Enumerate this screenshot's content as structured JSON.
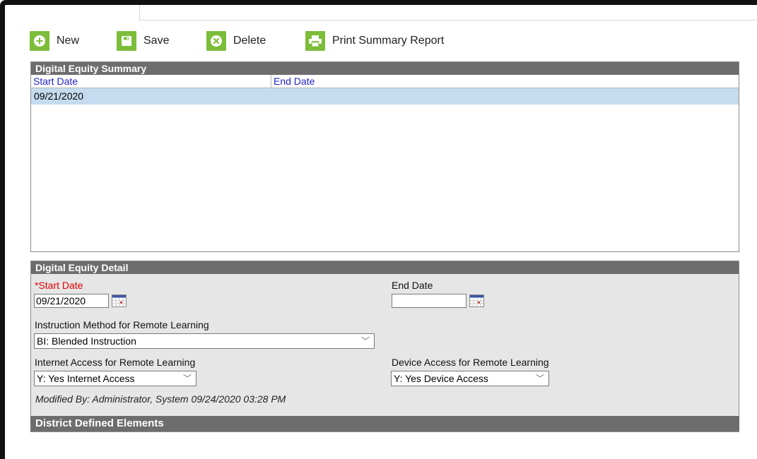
{
  "toolbar": {
    "new_label": "New",
    "save_label": "Save",
    "delete_label": "Delete",
    "print_label": "Print Summary Report"
  },
  "summary": {
    "title": "Digital Equity Summary",
    "columns": [
      "Start Date",
      "End Date"
    ],
    "rows": [
      {
        "start_date": "09/21/2020",
        "end_date": ""
      }
    ]
  },
  "detail": {
    "title": "Digital Equity Detail",
    "start_date": {
      "required_mark": "*",
      "label": "Start Date",
      "value": "09/21/2020"
    },
    "end_date": {
      "label": "End Date",
      "value": ""
    },
    "instruction_method": {
      "label": "Instruction Method for Remote Learning",
      "value": "BI: Blended Instruction"
    },
    "internet_access": {
      "label": "Internet Access for Remote Learning",
      "value": "Y: Yes Internet Access"
    },
    "device_access": {
      "label": "Device Access for Remote Learning",
      "value": "Y: Yes Device Access"
    },
    "modified": "Modified By: Administrator, System 09/24/2020 03:28 PM"
  },
  "district": {
    "title": "District Defined Elements"
  },
  "colors": {
    "accent_green": "#7cbd3a",
    "header_gray": "#6d6d6d",
    "selected_row": "#c5dbef",
    "link_blue": "#2222cc",
    "required_red": "#e00000"
  }
}
